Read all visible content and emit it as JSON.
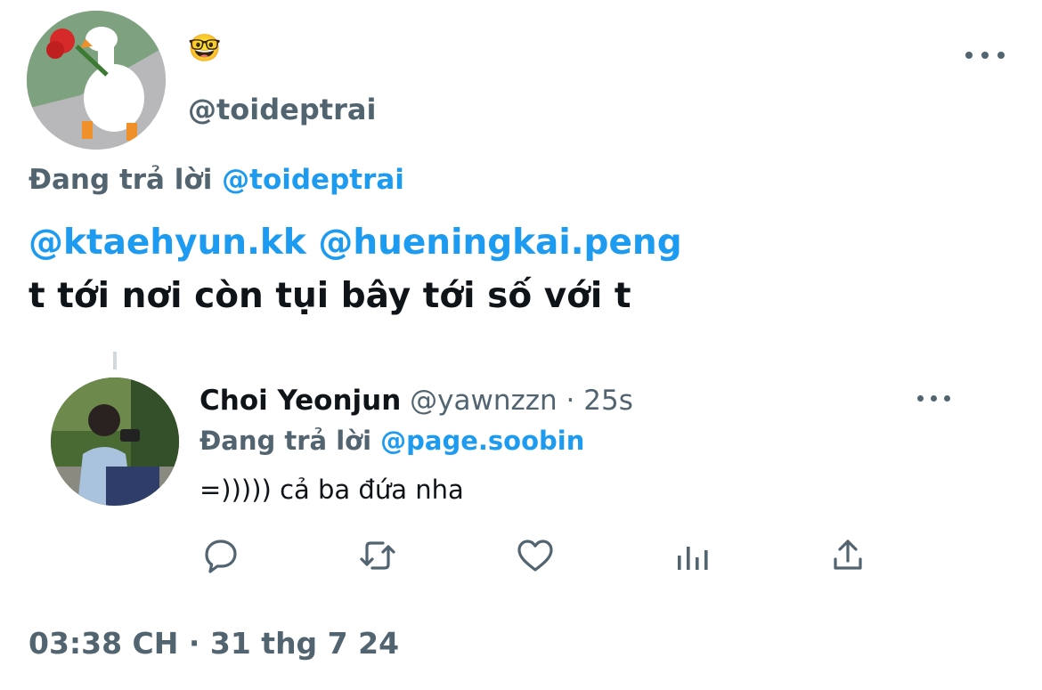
{
  "tweet": {
    "author": {
      "display_name": "🤓",
      "handle": "@toideptrai"
    },
    "reply_context": {
      "prefix": "Đang trả lời",
      "mention": "@toideptrai"
    },
    "mentions_line": "@ktaehyun.kk @hueningkai.peng",
    "body_line": "t tới nơi còn tụi bây tới số với t",
    "timestamp": "03:38 CH · 31 thg 7 24",
    "more_icon": "more-horizontal-icon"
  },
  "quoted": {
    "display_name": "Choi Yeonjun",
    "handle": "@yawnzzn",
    "separator": " · ",
    "time": "25s",
    "reply_context": {
      "prefix": "Đang trả lời",
      "mention": "@page.soobin"
    },
    "text": "=))))) cả ba đứa nha",
    "actions": [
      "reply-icon",
      "retweet-icon",
      "like-icon",
      "analytics-icon",
      "share-icon"
    ]
  },
  "colors": {
    "accent": "#1d9bf0",
    "muted": "#536471",
    "text": "#0f1419"
  }
}
